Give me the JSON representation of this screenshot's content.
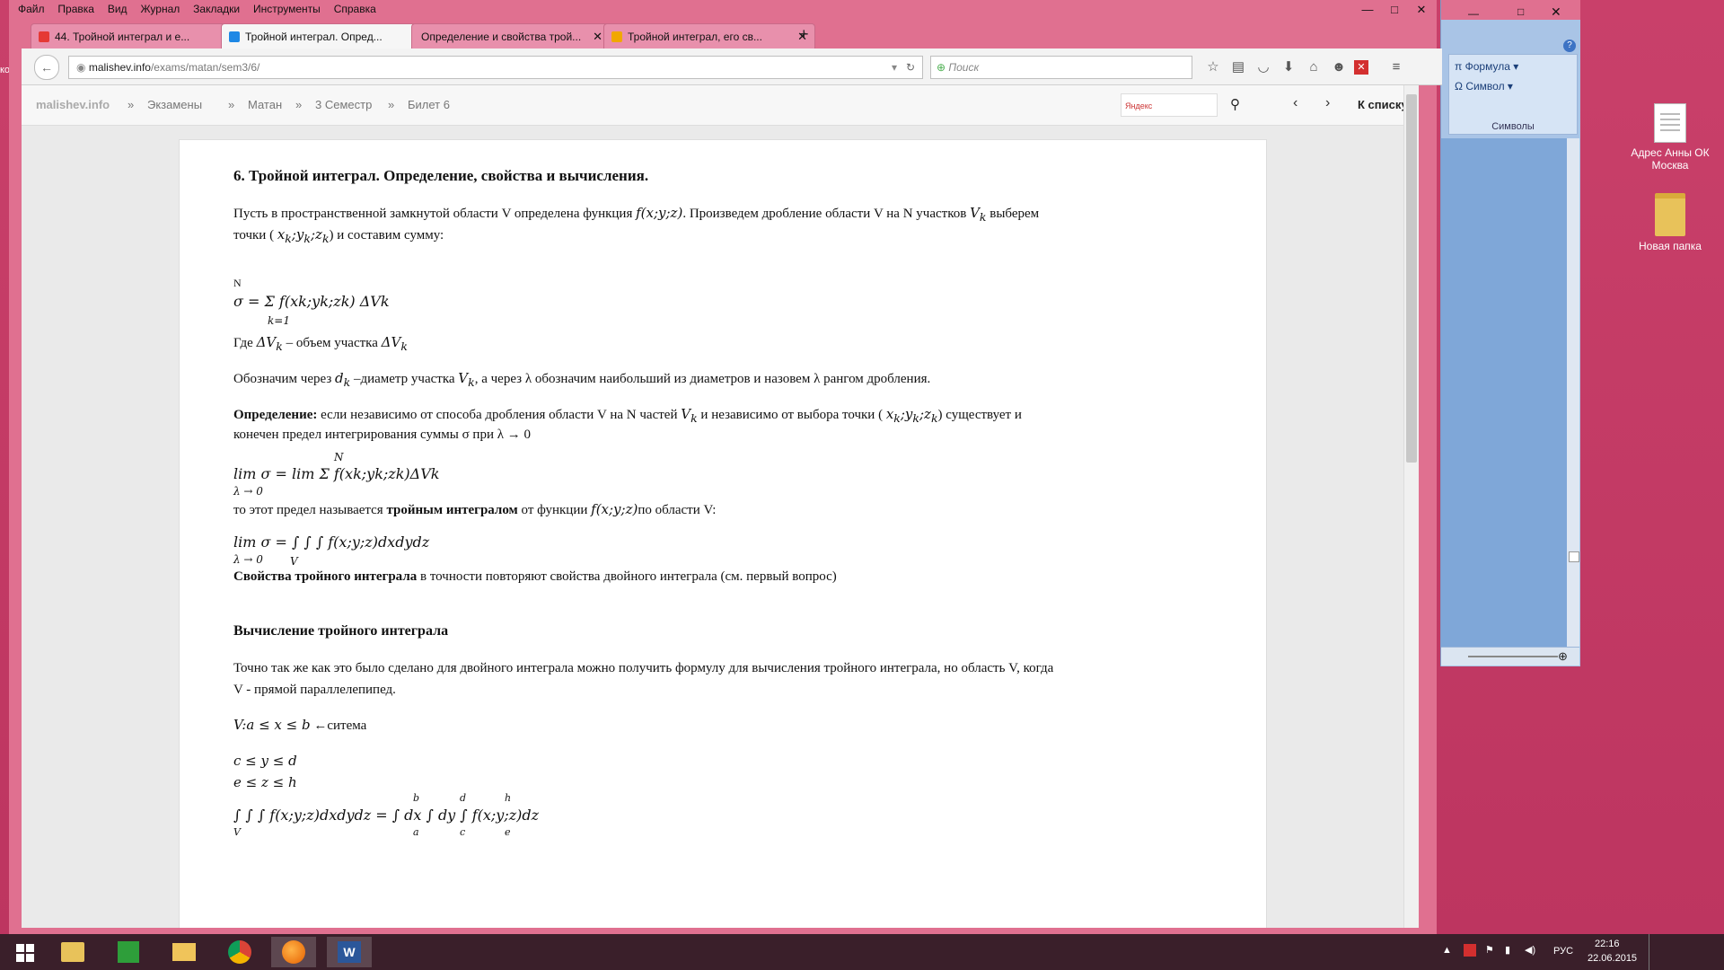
{
  "menubar": [
    "Файл",
    "Правка",
    "Вид",
    "Журнал",
    "Закладки",
    "Инструменты",
    "Справка"
  ],
  "tabs": [
    {
      "label": "44. Тройной интеграл и е...",
      "icon_color": "#e53935"
    },
    {
      "label": "Тройной интеграл. Опред...",
      "icon_color": "#1e88e5",
      "active": true
    },
    {
      "label": "Определение и свойства трой...",
      "icon_color": "#888888"
    },
    {
      "label": "Тройной интеграл, его св...",
      "icon_color": "#f1a800"
    }
  ],
  "new_tab_label": "+",
  "url": {
    "host": "malishev.info",
    "path": "/exams/matan/sem3/6/"
  },
  "search_placeholder": "Поиск",
  "breadcrumb": [
    "malishev.info",
    "»",
    "Экзамены",
    "»",
    "Матан",
    "»",
    "3 Семестр",
    "»",
    "Билет 6"
  ],
  "site_search_placeholder": "Яндекс",
  "back_to_list": "К списку",
  "doc": {
    "title": "6. Тройной интеграл. Определение, свойства и вычисления.",
    "p1a": "Пусть в пространственной замкнутой области V определена функция ",
    "p1_f": "f(x;y;z)",
    "p1b": ". Произведем дробление области V на N участков ",
    "p1_vk": "V",
    "p1c": " выберем",
    "p1d": "точки ( ",
    "p1_pt": "x",
    "p1e": ") и составим сумму:",
    "sum_formula": "σ = Σ f(xk;yk;zk) ΔVk",
    "sum_top": "N",
    "sum_bottom": "k=1",
    "where_a": "Где ",
    "where_dv": "ΔV",
    "where_b": " – объем участка ",
    "p2a": "Обозначим через ",
    "p2_d": "d",
    "p2b": " –диаметр участка ",
    "p2c": ", а через λ обозначим наибольший из диаметров и назовем λ рангом дробления.",
    "def_bold": "Определение:",
    "def_a": " если независимо от способа дробления области V на N частей ",
    "def_b": " и независимо от выбора точки ( ",
    "def_c": ") существует и",
    "def_d": "конечен предел интегрирования суммы σ при λ → 0",
    "lim_sum": "lim σ = lim Σ f(xk;yk;zk)ΔVk",
    "lim_sub": "λ → 0",
    "p3a": "то этот предел называется ",
    "p3_bold": "тройным интегралом",
    "p3b": " от функции ",
    "p3c": "по области V:",
    "lim_int": "lim σ = ∫ ∫ ∫ f(x;y;z)dxdydz",
    "int_sub": "V",
    "prop_bold": "Свойства тройного интеграла",
    "prop_text": " в точности повторяют свойства двойного интеграла (см. первый вопрос)",
    "calc_title": "Вычисление тройного интеграла",
    "calc_p1": "Точно так же как это было сделано для двойного интеграла можно получить формулу для вычисления тройного интеграла, но область V, когда",
    "calc_p2": "V - прямой параллелепипед.",
    "sys1": "V:a ≤ x ≤ b",
    "sys1_note": "←ситема",
    "sys2": "c ≤ y ≤ d",
    "sys3": "e ≤ z ≤ h",
    "final": "∫ ∫ ∫ f(x;y;z)dxdydz = ∫ dx ∫ dy ∫ f(x;y;z)dz",
    "final_limits": [
      "V",
      "a",
      "b",
      "c",
      "d",
      "e",
      "h"
    ]
  },
  "word_panel": {
    "formula": "Формула",
    "symbol": "Символ",
    "group": "Символы"
  },
  "desktop_icons": [
    {
      "label": "Адрес Анны ОК Москва"
    },
    {
      "label": "Новая папка"
    }
  ],
  "tray": {
    "lang": "РУС",
    "time": "22:16",
    "date": "22.06.2015"
  }
}
